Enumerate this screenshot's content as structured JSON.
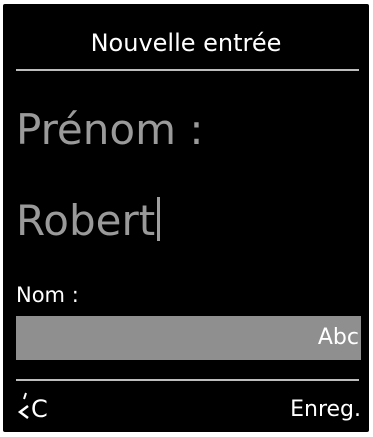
{
  "screen": {
    "title": "Nouvelle entrée",
    "first_name_label": "Prénom :",
    "first_name_value": "Robert",
    "last_name_label": "Nom :",
    "last_name_value": "",
    "input_mode": "Abc"
  },
  "softkeys": {
    "left_icon": "backspace-clear-icon",
    "left_label": "C",
    "right_label": "Enreg."
  },
  "colors": {
    "background": "#000000",
    "text_primary": "#ffffff",
    "text_dimmed": "#9a9a9a",
    "input_highlight": "#8f8f8f",
    "divider": "#bdbdbd"
  }
}
